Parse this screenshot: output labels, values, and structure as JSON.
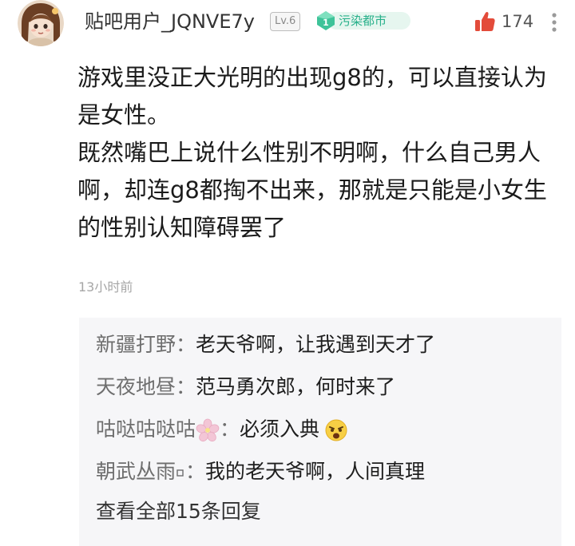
{
  "post": {
    "author": {
      "username": "贴吧用户_JQNVE7y",
      "level": "Lv.6",
      "forum_tag": "污染都市",
      "avatar_icon": "anime-girl-avatar"
    },
    "likes": {
      "icon": "thumbs-up-icon",
      "count": "174"
    },
    "more_icon": "more-options-icon",
    "content": {
      "paragraphs": [
        "游戏里没正大光明的出现g8的，可以直接认为是女性。",
        "既然嘴巴上说什么性别不明啊，什么自己男人啊，却连g8都掏不出来，那就是只能是小女生的性别认知障碍罢了"
      ]
    },
    "timestamp": "13小时前",
    "replies": [
      {
        "author": "新疆打野",
        "separator": "：",
        "text": "老天爷啊，让我遇到天才了"
      },
      {
        "author": "天夜地昼",
        "separator": "：",
        "text": "范马勇次郎，何时来了"
      },
      {
        "author": "咕哒咕哒咕",
        "author_icon": "cherry-blossom-icon",
        "separator": "：",
        "text": "必须入典",
        "text_icon": "astonished-emoji-icon"
      },
      {
        "author": "朝武丛雨",
        "author_icon": "small-square-icon",
        "separator": "：",
        "text": "我的老天爷啊，人间真理"
      }
    ],
    "view_all": "查看全部15条回复"
  },
  "colors": {
    "level_badge": "#8a8a8a",
    "forum_tag": "#27b08a",
    "like_icon": "#e34b3a",
    "reply_author": "#6e6e6e",
    "timestamp": "#a6a6a6",
    "reply_background": "#f6f6f8"
  }
}
